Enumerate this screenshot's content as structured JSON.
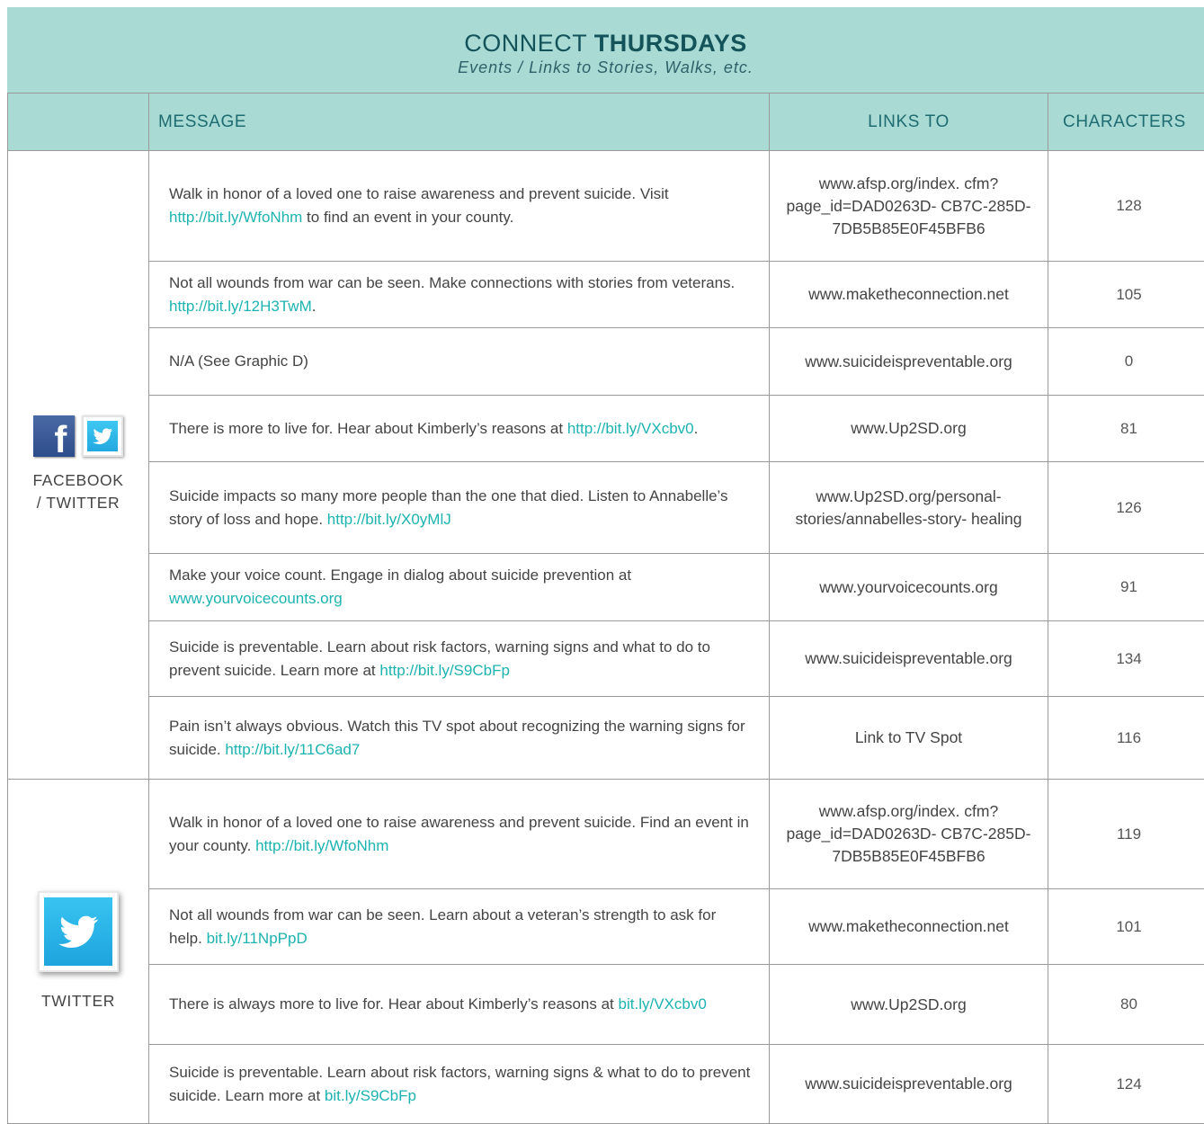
{
  "header": {
    "title_prefix": "CONNECT",
    "title_bold": "THURSDAYS",
    "subtitle": "Events / Links to Stories, Walks, etc."
  },
  "columns": {
    "message": "MESSAGE",
    "links_to": "LINKS TO",
    "characters": "CHARACTERS"
  },
  "colors": {
    "banner": "#a9dbd4",
    "link": "#1cb3b0",
    "heading_text": "#1e6b72"
  },
  "groups": [
    {
      "platform_label_line1": "FACEBOOK",
      "platform_label_line2": "/ TWITTER",
      "icons": [
        "facebook-icon",
        "twitter-icon"
      ],
      "rows": [
        {
          "text": "Walk in honor of a loved one to raise awareness and prevent suicide. Visit ",
          "url": "http://bit.ly/WfoNhm",
          "after": " to find an event in your county.",
          "links_to": "www.afsp.org/index. cfm?page_id=DAD0263D- CB7C-285D- 7DB5B85E0F45BFB6",
          "characters": "128"
        },
        {
          "text": "Not all wounds from war can be seen. Make connections with stories from veterans. ",
          "url": "http://bit.ly/12H3TwM",
          "after": ".",
          "links_to": "www.maketheconnection.net",
          "characters": "105"
        },
        {
          "text": "N/A (See Graphic D)",
          "url": "",
          "after": "",
          "links_to": "www.suicideispreventable.org",
          "characters": "0"
        },
        {
          "text": "There is more to live for. Hear about Kimberly’s reasons at ",
          "url": "http://bit.ly/VXcbv0",
          "after": ".",
          "links_to": "www.Up2SD.org",
          "characters": "81"
        },
        {
          "text": "Suicide impacts so many more people than the one that died. Listen to Annabelle’s story of loss and hope. ",
          "url": "http://bit.ly/X0yMlJ",
          "after": "",
          "links_to": "www.Up2SD.org/personal- stories/annabelles-story- healing",
          "characters": "126"
        },
        {
          "text": "Make your voice count. Engage in dialog about suicide prevention at ",
          "url": "www.yourvoicecounts.org",
          "after": "",
          "links_to": "www.yourvoicecounts.org",
          "characters": "91"
        },
        {
          "text": "Suicide is preventable. Learn about risk factors, warning signs and what to do to prevent suicide. Learn more at ",
          "url": "http://bit.ly/S9CbFp",
          "after": "",
          "links_to": "www.suicideispreventable.org",
          "characters": "134"
        },
        {
          "text": "Pain isn’t always obvious. Watch this TV spot about recognizing the warning signs for suicide. ",
          "url": "http://bit.ly/11C6ad7",
          "after": "",
          "links_to": "Link to TV Spot",
          "characters": "116"
        }
      ]
    },
    {
      "platform_label_line1": "TWITTER",
      "platform_label_line2": "",
      "icons": [
        "twitter-icon"
      ],
      "rows": [
        {
          "text": "Walk in honor of a loved one to raise awareness and prevent suicide. Find an event in your county. ",
          "url": "http://bit.ly/WfoNhm",
          "after": "",
          "links_to": "www.afsp.org/index. cfm?page_id=DAD0263D- CB7C-285D- 7DB5B85E0F45BFB6",
          "characters": "119"
        },
        {
          "text": "Not all wounds from war can be seen. Learn about a veteran’s strength to ask for help. ",
          "url": "bit.ly/11NpPpD",
          "after": "",
          "links_to": "www.maketheconnection.net",
          "characters": "101"
        },
        {
          "text": "There is always more to live for. Hear about Kimberly’s reasons at ",
          "url": "bit.ly/VXcbv0",
          "after": "",
          "links_to": "www.Up2SD.org",
          "characters": "80"
        },
        {
          "text": "Suicide is preventable. Learn about risk factors, warning signs & what to do to prevent suicide. Learn more at ",
          "url": "bit.ly/S9CbFp",
          "after": "",
          "links_to": "www.suicideispreventable.org",
          "characters": "124"
        }
      ]
    }
  ]
}
